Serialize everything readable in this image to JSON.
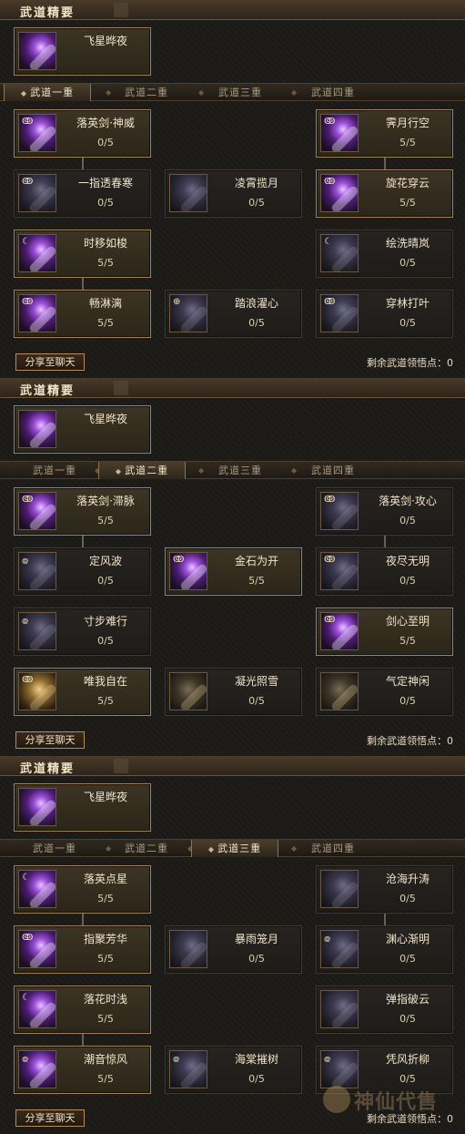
{
  "panels": [
    {
      "header": "武道精要",
      "essence": {
        "name": "飞星晔夜"
      },
      "tabs": [
        "武道一重",
        "武道二重",
        "武道三重",
        "武道四重"
      ],
      "selected_tab": 0,
      "skills": [
        {
          "name": "落英剑·神威",
          "level": "0/5"
        },
        {
          "name": "霁月行空",
          "level": "5/5"
        },
        {
          "name": "一指透春寒",
          "level": "0/5"
        },
        {
          "name": "凌霄揽月",
          "level": "0/5"
        },
        {
          "name": "旋花穿云",
          "level": "5/5"
        },
        {
          "name": "时移如梭",
          "level": "5/5"
        },
        {
          "name": "绘洗晴岚",
          "level": "0/5"
        },
        {
          "name": "畅淋漓",
          "level": "5/5"
        },
        {
          "name": "踏浪濯心",
          "level": "0/5"
        },
        {
          "name": "穿林打叶",
          "level": "0/5"
        }
      ],
      "share_label": "分享至聊天",
      "remaining_label": "剩余武道领悟点：0"
    },
    {
      "header": "武道精要",
      "essence": {
        "name": "飞星晔夜"
      },
      "tabs": [
        "武道一重",
        "武道二重",
        "武道三重",
        "武道四重"
      ],
      "selected_tab": 1,
      "skills": [
        {
          "name": "落英剑·滞脉",
          "level": "5/5"
        },
        {
          "name": "落英剑·攻心",
          "level": "0/5"
        },
        {
          "name": "定风波",
          "level": "0/5"
        },
        {
          "name": "金石为开",
          "level": "5/5"
        },
        {
          "name": "夜尽无明",
          "level": "0/5"
        },
        {
          "name": "寸步难行",
          "level": "0/5"
        },
        {
          "name": "剑心至明",
          "level": "5/5"
        },
        {
          "name": "唯我自在",
          "level": "5/5"
        },
        {
          "name": "凝光照雪",
          "level": "0/5"
        },
        {
          "name": "气定神闲",
          "level": "0/5"
        }
      ],
      "share_label": "分享至聊天",
      "remaining_label": "剩余武道领悟点：0"
    },
    {
      "header": "武道精要",
      "essence": {
        "name": "飞星晔夜"
      },
      "tabs": [
        "武道一重",
        "武道二重",
        "武道三重",
        "武道四重"
      ],
      "selected_tab": 2,
      "skills": [
        {
          "name": "落英点星",
          "level": "5/5"
        },
        {
          "name": "沧海升涛",
          "level": "0/5"
        },
        {
          "name": "指聚芳华",
          "level": "5/5"
        },
        {
          "name": "暴雨笼月",
          "level": "0/5"
        },
        {
          "name": "渊心渐明",
          "level": "0/5"
        },
        {
          "name": "落花时浅",
          "level": "5/5"
        },
        {
          "name": "弹指破云",
          "level": "0/5"
        },
        {
          "name": "潮音惊风",
          "level": "5/5"
        },
        {
          "name": "海棠摧树",
          "level": "0/5"
        },
        {
          "name": "凭风折柳",
          "level": "0/5"
        }
      ],
      "share_label": "分享至聊天",
      "remaining_label": "剩余武道领悟点：0"
    }
  ],
  "watermark": "神仙代售",
  "colors": {
    "accent": "#a08452",
    "purple_glow": "#9a4fd6",
    "background": "#1c1a17"
  }
}
